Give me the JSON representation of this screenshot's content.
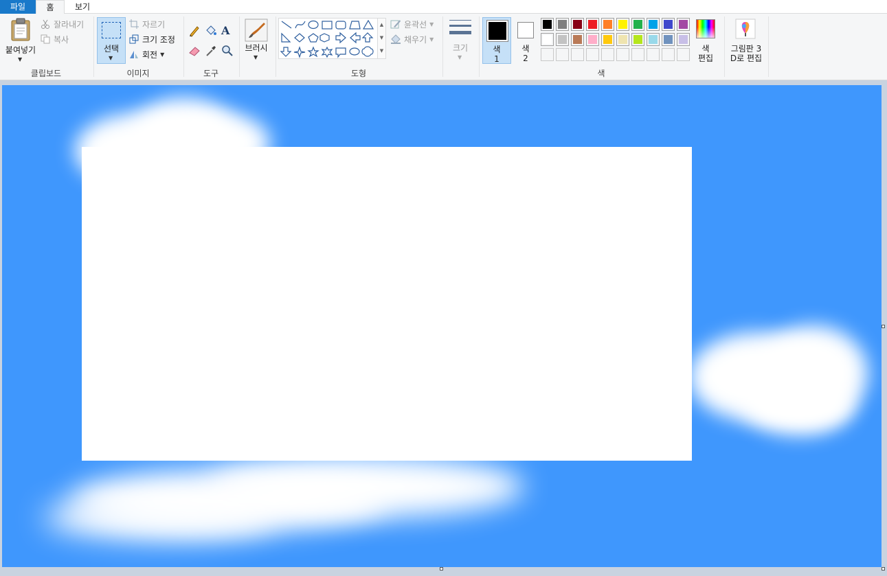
{
  "tabs": {
    "file": "파일",
    "home": "홈",
    "view": "보기"
  },
  "clipboard": {
    "group_label": "클립보드",
    "paste": "붙여넣기",
    "cut": "잘라내기",
    "copy": "복사",
    "paste_icon": "clipboard-icon",
    "cut_icon": "scissors-icon",
    "copy_icon": "copy-icon"
  },
  "image": {
    "group_label": "이미지",
    "select": "선택",
    "crop": "자르기",
    "resize": "크기 조정",
    "rotate": "회전"
  },
  "tools": {
    "group_label": "도구",
    "icons": [
      "pencil-icon",
      "fill-bucket-icon",
      "text-icon",
      "eraser-icon",
      "color-picker-icon",
      "magnifier-icon"
    ],
    "text_glyph": "A"
  },
  "brushes": {
    "label": "브러시"
  },
  "shapes": {
    "group_label": "도형",
    "outline": "윤곽선",
    "fill": "채우기"
  },
  "size": {
    "label": "크기"
  },
  "colors": {
    "group_label": "색",
    "color1_line1": "색",
    "color1_line2": "1",
    "color2_line1": "색",
    "color2_line2": "2",
    "edit_line1": "색",
    "edit_line2": "편집",
    "color1": "#000000",
    "color2": "#ffffff",
    "row1": [
      "#000000",
      "#7f7f7f",
      "#880015",
      "#ed1c24",
      "#ff7f27",
      "#fff200",
      "#22b14c",
      "#00a2e8",
      "#3f48cc",
      "#a349a4"
    ],
    "row2": [
      "#ffffff",
      "#c3c3c3",
      "#b97a57",
      "#ffaec9",
      "#ffc90e",
      "#efe4b0",
      "#b5e61d",
      "#99d9ea",
      "#7092be",
      "#c8bfe7"
    ]
  },
  "paint3d": {
    "line1": "그림판 3",
    "line2": "D로 편집"
  },
  "canvas": {
    "background": "#3f97fd"
  }
}
